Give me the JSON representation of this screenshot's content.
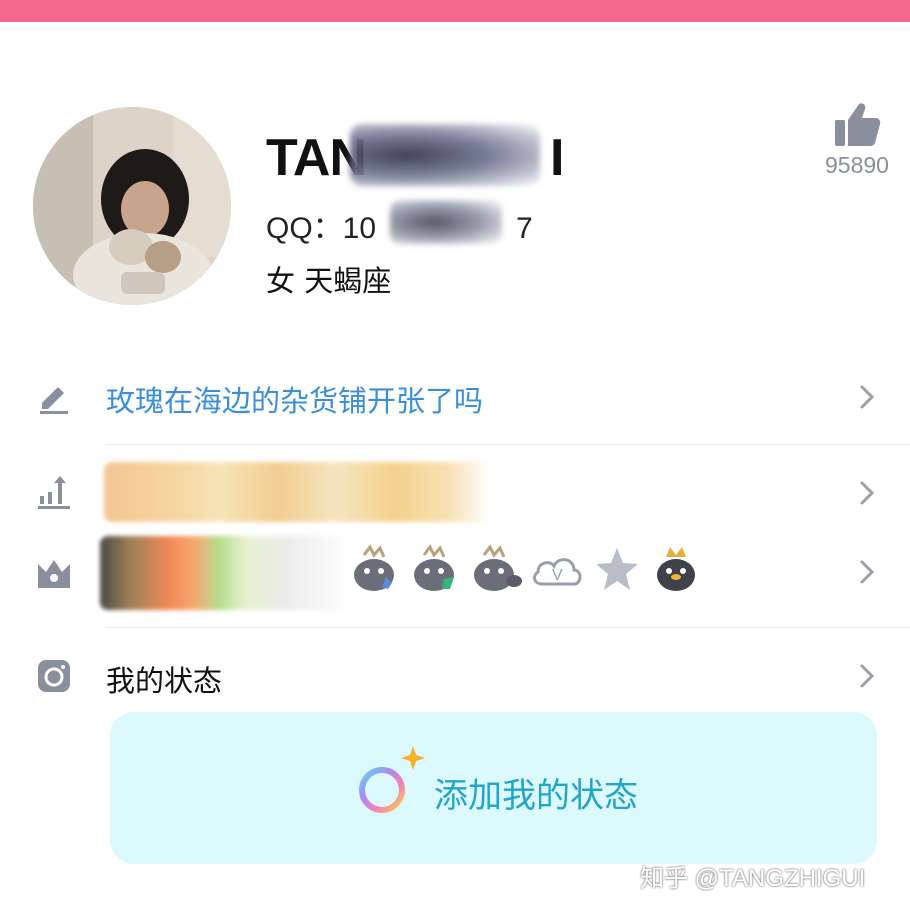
{
  "header": {
    "accent_color": "#f7678c"
  },
  "profile": {
    "name_visible": "TAN",
    "name_tail_visible": "I",
    "qq_label": "QQ：10",
    "qq_tail": "7",
    "gender_constellation": "女  天蝎座",
    "likes": "95890"
  },
  "rows": {
    "signature": "玫瑰在海边的杂货铺开张了吗",
    "my_status": "我的状态"
  },
  "add_status": {
    "label": "添加我的状态"
  },
  "watermark": "知乎 @TANGZHIGUI",
  "colors": {
    "link_blue": "#3a8fd8",
    "card_bg": "#dcf9fd",
    "card_text": "#21a6c8",
    "icon_gray": "#8a8f9e"
  },
  "icons": [
    "thumb-up-icon",
    "pencil-icon",
    "bar-chart-icon",
    "crown-icon",
    "instagram-icon",
    "chevron-right-icon",
    "ring-icon",
    "sparkle-icon"
  ]
}
